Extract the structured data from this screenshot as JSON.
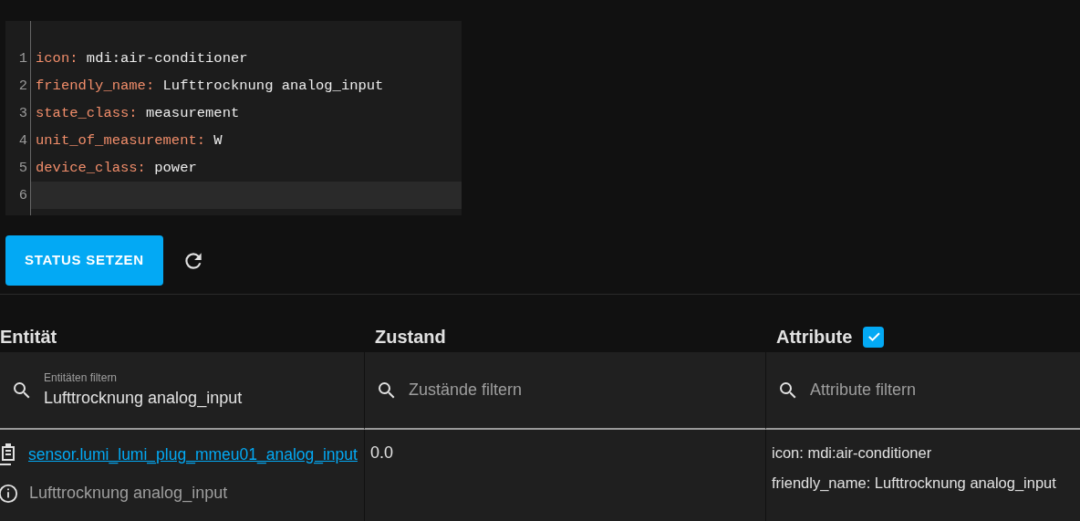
{
  "editor": {
    "lines": [
      {
        "number": "1",
        "key": "icon:",
        "value": "mdi:air-conditioner",
        "active": false
      },
      {
        "number": "2",
        "key": "friendly_name:",
        "value": "Lufttrocknung analog_input",
        "active": false
      },
      {
        "number": "3",
        "key": "state_class:",
        "value": "measurement",
        "active": false
      },
      {
        "number": "4",
        "key": "unit_of_measurement:",
        "value": "W",
        "active": false
      },
      {
        "number": "5",
        "key": "device_class:",
        "value": "power",
        "active": false
      },
      {
        "number": "6",
        "active": true
      }
    ]
  },
  "set_state_button": "STATUS SETZEN",
  "table": {
    "columns": [
      {
        "label": "Entität",
        "filter": {
          "label": "Entitäten filtern",
          "value": "Lufttrocknung analog_input"
        }
      },
      {
        "label": "Zustand",
        "filter": {
          "placeholder": "Zustände filtern"
        }
      },
      {
        "label": "Attribute",
        "checked": true,
        "filter": {
          "placeholder": "Attribute filtern"
        }
      }
    ],
    "rows": [
      {
        "entity_id": "sensor.lumi_lumi_plug_mmeu01_analog_input",
        "friendly_name": "Lufttrocknung analog_input",
        "state": "0.0",
        "attributes": [
          "icon: mdi:air-conditioner",
          "friendly_name: Lufttrocknung analog_input"
        ]
      }
    ]
  }
}
